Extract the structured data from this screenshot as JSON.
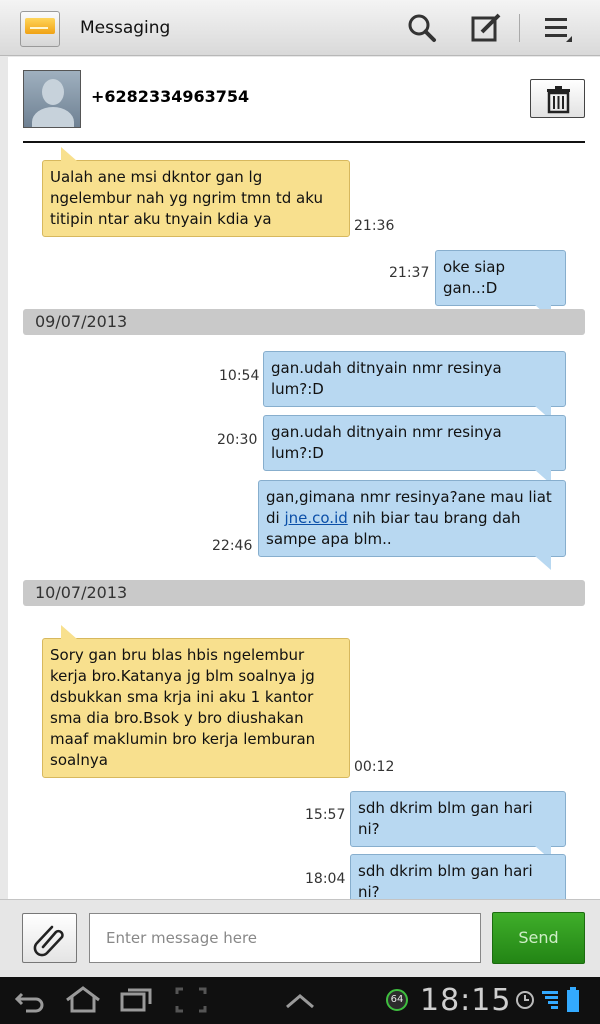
{
  "app": {
    "title": "Messaging"
  },
  "contact": {
    "number": "+6282334963754"
  },
  "dates": [
    "09/07/2013",
    "10/07/2013"
  ],
  "messages": [
    {
      "dir": "in",
      "text": "Ualah ane msi dkntor gan lg ngelembur nah yg ngrim tmn td aku titipin ntar aku tnyain kdia ya",
      "time": "21:36"
    },
    {
      "dir": "out",
      "text": "oke siap gan..:D",
      "time": "21:37"
    },
    {
      "dir": "out",
      "text": "gan.udah ditnyain nmr resinya lum?:D",
      "time": "10:54"
    },
    {
      "dir": "out",
      "text": "gan.udah ditnyain nmr resinya lum?:D",
      "time": "20:30"
    },
    {
      "dir": "out",
      "text_before": "gan,gimana nmr resinya?ane mau liat di ",
      "link": "jne.co.id",
      "text_after": " nih biar tau brang dah sampe apa blm..",
      "time": "22:46"
    },
    {
      "dir": "in",
      "text": "Sory gan bru blas hbis ngelembur kerja bro.Katanya jg blm soalnya jg dsbukkan sma krja ini aku 1 kantor sma dia bro.Bsok y bro diushakan maaf maklumin bro kerja lemburan soalnya",
      "time": "00:12"
    },
    {
      "dir": "out",
      "text": "sdh dkrim blm gan hari ni?",
      "time": "15:57"
    },
    {
      "dir": "out",
      "text": "sdh dkrim blm gan hari ni?",
      "time": "18:04"
    }
  ],
  "compose": {
    "placeholder": "Enter message here",
    "send_label": "Send"
  },
  "status": {
    "time": "18:15",
    "notification_count": "64"
  },
  "icons": {
    "app": "messaging-envelope-icon",
    "search": "search-icon",
    "compose": "compose-icon",
    "menu": "menu-icon",
    "delete": "trash-icon",
    "attach": "paperclip-icon",
    "back": "back-icon",
    "home": "home-icon",
    "recent": "recent-apps-icon",
    "screenshot": "screenshot-icon",
    "up": "chevron-up-icon",
    "alarm": "alarm-icon",
    "signal": "signal-icon",
    "battery": "battery-icon"
  },
  "colors": {
    "incoming": "#f8e08e",
    "outgoing": "#b8d8f1",
    "send": "#2f9a1f"
  }
}
